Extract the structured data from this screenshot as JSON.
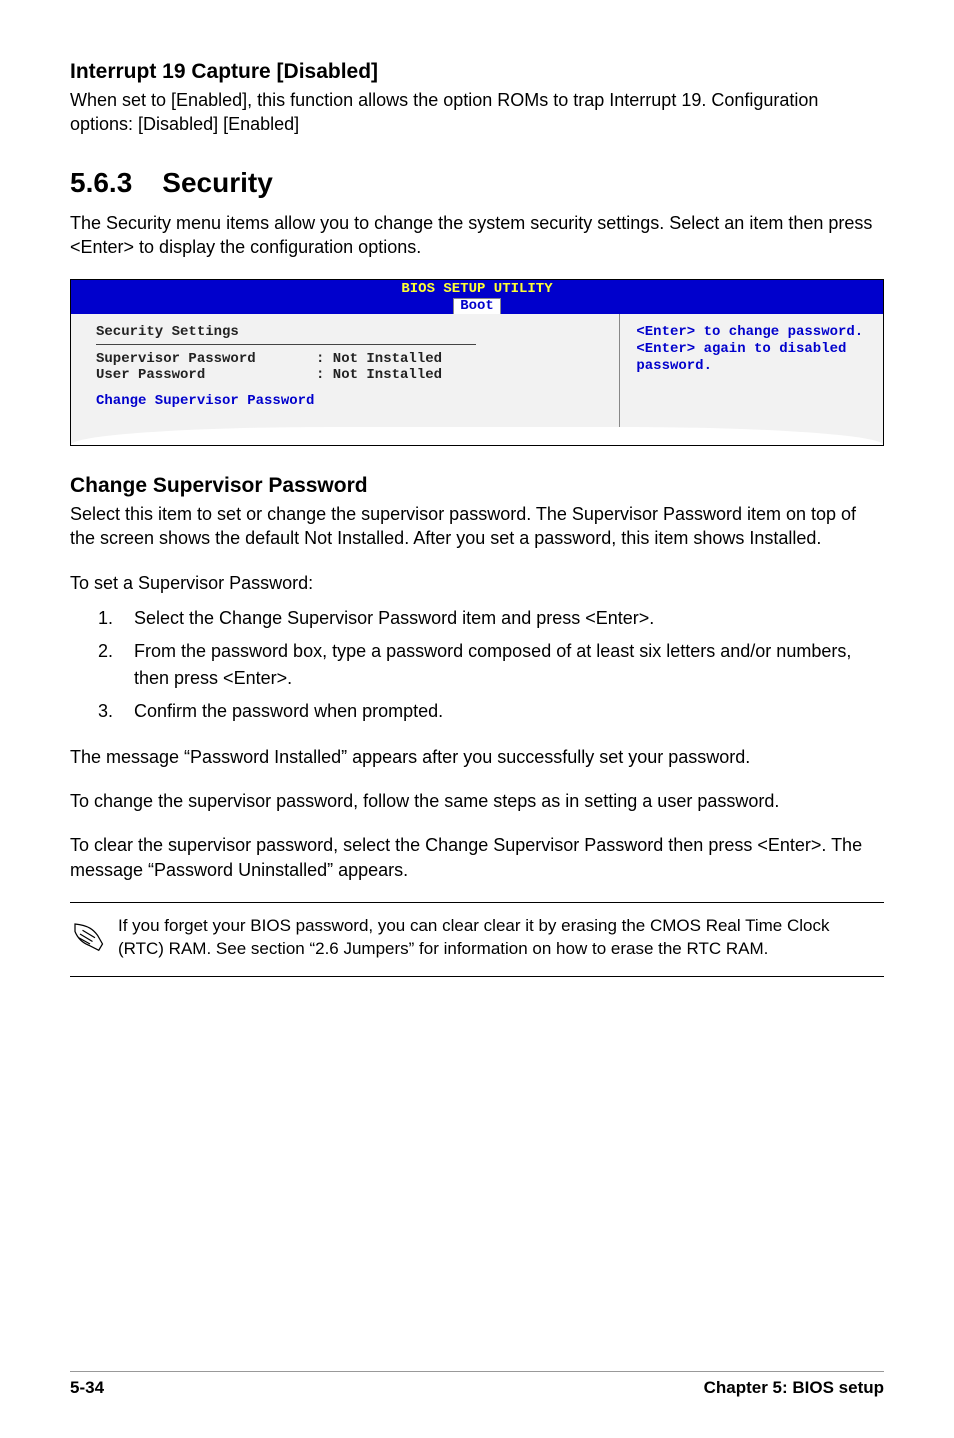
{
  "sec1": {
    "title": "Interrupt 19 Capture [Disabled]",
    "body": "When set to [Enabled], this function allows the option ROMs to trap Interrupt 19. Configuration options: [Disabled] [Enabled]"
  },
  "sec2": {
    "num": "5.6.3",
    "title": "Security",
    "intro": "The Security menu items allow you to change the system security settings. Select an item then press <Enter> to display the configuration options."
  },
  "bios": {
    "title": "BIOS SETUP UTILITY",
    "tab": "Boot",
    "left_heading": "Security Settings",
    "rows": [
      {
        "label": "Supervisor Password",
        "value": ": Not Installed"
      },
      {
        "label": "User Password",
        "value": ": Not Installed"
      }
    ],
    "change_line": "Change Supervisor Password",
    "help1": "<Enter> to change password.",
    "help2": "<Enter> again to disabled password."
  },
  "change": {
    "title": "Change Supervisor Password",
    "p1": "Select this item to set or change the supervisor password. The Supervisor Password item on top of the screen shows the default Not Installed. After you set a password, this item shows Installed.",
    "p2": "To set a Supervisor Password:",
    "steps": [
      "Select the Change Supervisor Password item and press <Enter>.",
      "From the password box, type a password composed of at least six letters and/or numbers, then press <Enter>.",
      "Confirm the password when prompted."
    ],
    "p3": "The message “Password Installed” appears after you successfully set your password.",
    "p4": "To change the supervisor password, follow the same steps as in setting a user password.",
    "p5": "To clear the supervisor password, select the Change Supervisor Password then press <Enter>. The message “Password Uninstalled” appears."
  },
  "note": {
    "text": "If you forget your BIOS password, you can clear clear it by erasing the CMOS Real Time Clock (RTC) RAM. See section “2.6  Jumpers” for information on how to erase the RTC RAM."
  },
  "footer": {
    "left": "5-34",
    "right": "Chapter 5: BIOS setup"
  }
}
